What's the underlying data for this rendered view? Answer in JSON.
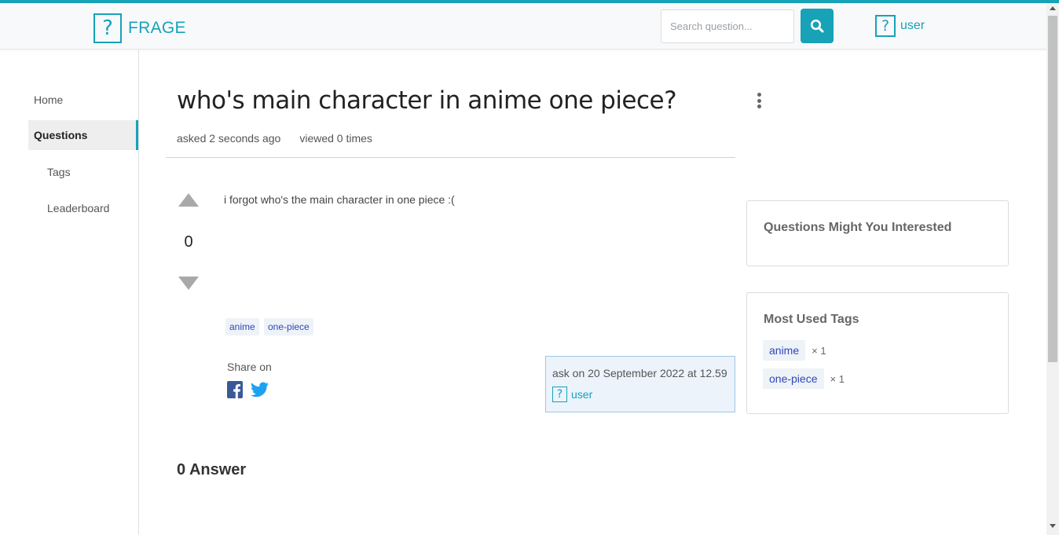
{
  "header": {
    "logo_glyph": "?",
    "brand": "FRAGE",
    "search_placeholder": "Search question...",
    "search_icon": "magnifier-icon",
    "user_name": "user"
  },
  "sidebar": {
    "items": [
      {
        "label": "Home"
      },
      {
        "label": "Questions",
        "active": true
      },
      {
        "label": "Tags"
      },
      {
        "label": "Leaderboard"
      }
    ]
  },
  "question": {
    "title": "who's main character in anime one piece?",
    "asked": "asked 2 seconds ago",
    "viewed": "viewed 0 times",
    "votes": "0",
    "body": "i forgot who's the main character in one piece :(",
    "tags": [
      "anime",
      "one-piece"
    ],
    "share_label": "Share on",
    "ask_info": "ask on 20 September 2022 at 12.59",
    "ask_user": "user"
  },
  "answers": {
    "count_label": "0 Answer"
  },
  "panels": {
    "suggest_title": "Questions Might You Interested",
    "tags_title": "Most Used Tags",
    "tags": [
      {
        "name": "anime",
        "count": "× 1"
      },
      {
        "name": "one-piece",
        "count": "× 1"
      }
    ]
  },
  "colors": {
    "accent": "#17a2b8",
    "tag_text": "#3146b8",
    "tag_bg": "#eef3f8",
    "facebook": "#3b5998",
    "twitter": "#1da1f2"
  }
}
